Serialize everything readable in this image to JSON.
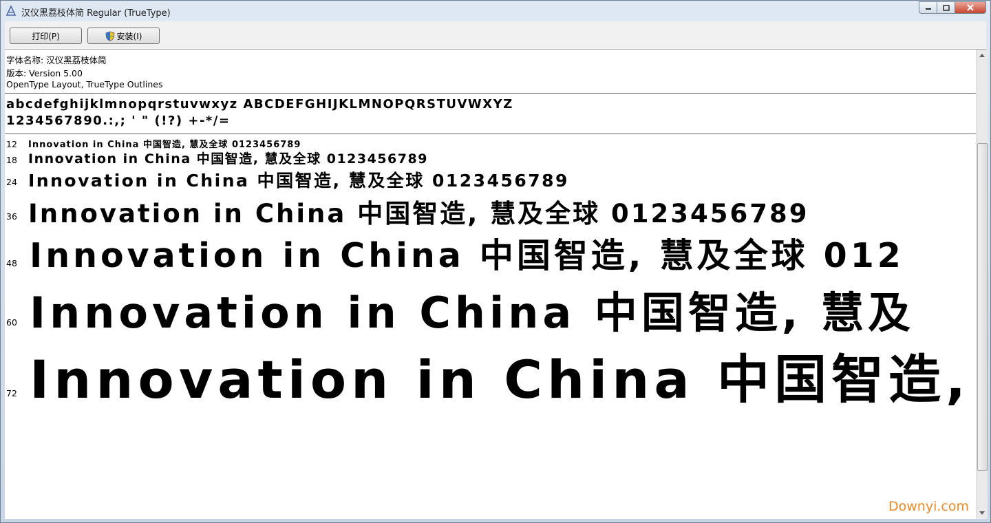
{
  "window": {
    "title": "汉仪黑荔枝体简 Regular (TrueType)"
  },
  "toolbar": {
    "print_label": "打印(P)",
    "install_label": "安装(I)"
  },
  "font_info": {
    "name_line": "字体名称: 汉仪黑荔枝体简",
    "version_line": "版本: Version 5.00",
    "type_line": "OpenType Layout, TrueType Outlines"
  },
  "charset": {
    "line1": "abcdefghijklmnopqrstuvwxyz ABCDEFGHIJKLMNOPQRSTUVWXYZ",
    "line2": "1234567890.:,; ' \" (!?) +-*/="
  },
  "samples": [
    {
      "size": "12",
      "text": "Innovation in China 中国智造, 慧及全球 0123456789"
    },
    {
      "size": "18",
      "text": "Innovation in China 中国智造, 慧及全球 0123456789"
    },
    {
      "size": "24",
      "text": "Innovation in China 中国智造, 慧及全球 0123456789"
    },
    {
      "size": "36",
      "text": "Innovation in China 中国智造, 慧及全球 0123456789"
    },
    {
      "size": "48",
      "text": "Innovation in China 中国智造, 慧及全球 012"
    },
    {
      "size": "60",
      "text": "Innovation in China 中国智造, 慧及"
    },
    {
      "size": "72",
      "text": "Innovation in China 中国智造,"
    }
  ],
  "watermark": "Downyi.com",
  "icons": {
    "app": "font-file-icon",
    "shield": "uac-shield-icon"
  }
}
